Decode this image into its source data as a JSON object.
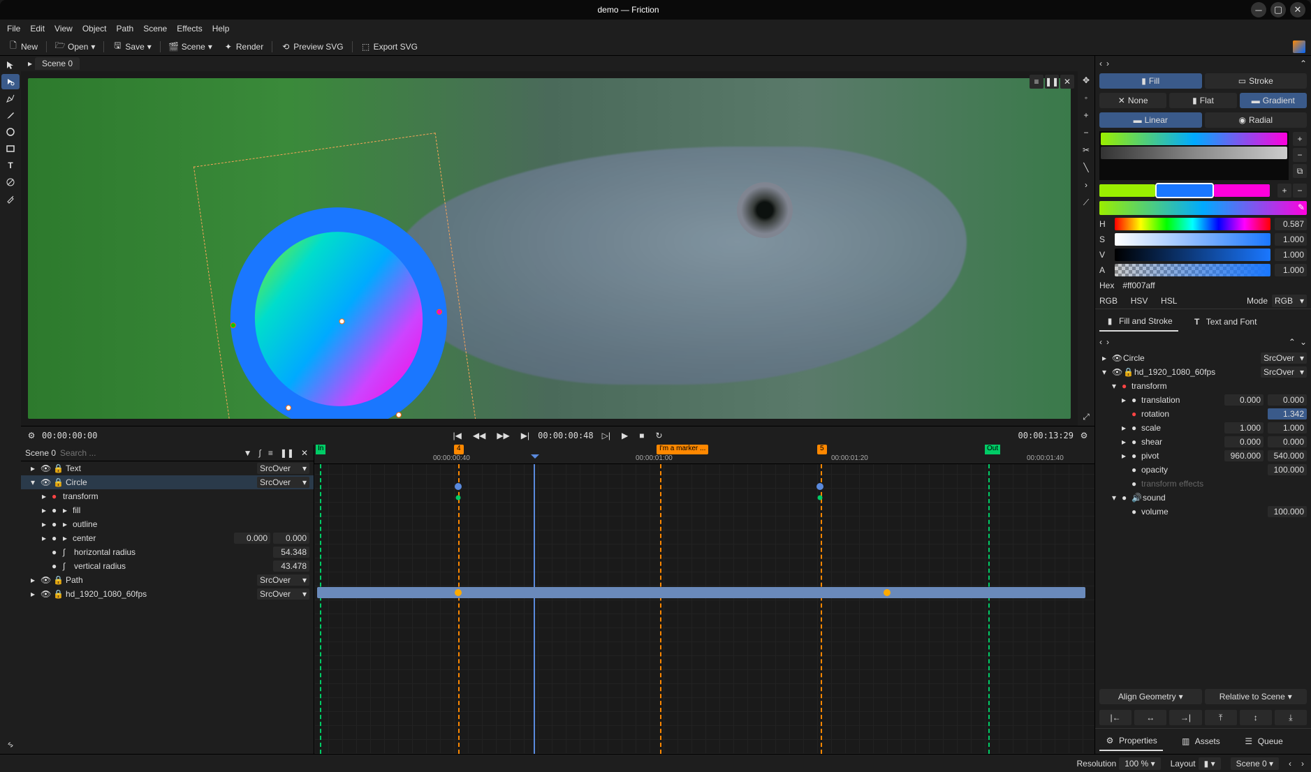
{
  "window": {
    "title": "demo — Friction"
  },
  "menus": [
    "File",
    "Edit",
    "View",
    "Object",
    "Path",
    "Scene",
    "Effects",
    "Help"
  ],
  "toolbar": {
    "new": "New",
    "open": "Open",
    "save": "Save",
    "scene": "Scene",
    "render": "Render",
    "preview_svg": "Preview SVG",
    "export_svg": "Export SVG"
  },
  "scene_tab": "Scene 0",
  "fillstroke": {
    "fill": "Fill",
    "stroke": "Stroke",
    "none": "None",
    "flat": "Flat",
    "gradient": "Gradient",
    "linear": "Linear",
    "radial": "Radial"
  },
  "color": {
    "h": {
      "label": "H",
      "val": "0.587"
    },
    "s": {
      "label": "S",
      "val": "1.000"
    },
    "v": {
      "label": "V",
      "val": "1.000"
    },
    "a": {
      "label": "A",
      "val": "1.000"
    },
    "hex_label": "Hex",
    "hex": "#ff007aff",
    "rgb": "RGB",
    "hsv": "HSV",
    "hsl": "HSL",
    "mode_label": "Mode",
    "mode": "RGB"
  },
  "panel_tabs": {
    "fillstroke": "Fill and Stroke",
    "text": "Text and Font"
  },
  "tree": [
    {
      "indent": 0,
      "exp": "▸",
      "name": "Circle",
      "blend": "SrcOver"
    },
    {
      "indent": 0,
      "exp": "▾",
      "name": "hd_1920_1080_60fps",
      "blend": "SrcOver",
      "lock": true
    },
    {
      "indent": 1,
      "exp": "▾",
      "name": "transform",
      "red": true
    },
    {
      "indent": 2,
      "exp": "▸",
      "name": "translation",
      "vals": [
        "0.000",
        "0.000"
      ]
    },
    {
      "indent": 2,
      "name": "rotation",
      "vals": [
        "1.342"
      ],
      "sel": true,
      "red": true
    },
    {
      "indent": 2,
      "exp": "▸",
      "name": "scale",
      "vals": [
        "1.000",
        "1.000"
      ]
    },
    {
      "indent": 2,
      "exp": "▸",
      "name": "shear",
      "vals": [
        "0.000",
        "0.000"
      ]
    },
    {
      "indent": 2,
      "exp": "▸",
      "name": "pivot",
      "vals": [
        "960.000",
        "540.000"
      ]
    },
    {
      "indent": 2,
      "name": "opacity",
      "vals": [
        "100.000"
      ]
    },
    {
      "indent": 2,
      "name": "transform effects",
      "dim": true
    },
    {
      "indent": 1,
      "exp": "▾",
      "name": "sound",
      "sound": true
    },
    {
      "indent": 2,
      "name": "volume",
      "vals": [
        "100.000"
      ]
    }
  ],
  "align": {
    "geom": "Align Geometry",
    "rel": "Relative to Scene"
  },
  "bottom_tabs": {
    "props": "Properties",
    "assets": "Assets",
    "queue": "Queue"
  },
  "timeline": {
    "start": "00:00:00:00",
    "current": "00:00:00:48",
    "end": "00:00:13:29",
    "scene": "Scene 0",
    "search_ph": "Search ...",
    "ticks": [
      "00:00:00:40",
      "00:00:01:00",
      "00:00:01:20",
      "00:00:01:40"
    ],
    "markers": {
      "in": "In",
      "out": "Out",
      "m4": "4",
      "m5": "5",
      "text": "I'm a marker ..."
    },
    "items": [
      {
        "indent": 0,
        "exp": "▸",
        "name": "Text",
        "blend": "SrcOver",
        "vis": true,
        "lock": true
      },
      {
        "indent": 0,
        "exp": "▾",
        "name": "Circle",
        "blend": "SrcOver",
        "vis": true,
        "lock": true,
        "sel": true
      },
      {
        "indent": 1,
        "exp": "▸",
        "name": "transform",
        "red": true
      },
      {
        "indent": 1,
        "exp": "▸",
        "name": "fill"
      },
      {
        "indent": 1,
        "exp": "▸",
        "name": "outline"
      },
      {
        "indent": 1,
        "exp": "▸",
        "name": "center",
        "vals": [
          "0.000",
          "0.000"
        ]
      },
      {
        "indent": 1,
        "name": "horizontal radius",
        "vals": [
          "54.348"
        ],
        "curve": true
      },
      {
        "indent": 1,
        "name": "vertical radius",
        "vals": [
          "43.478"
        ],
        "curve": true
      },
      {
        "indent": 0,
        "exp": "▸",
        "name": "Path",
        "blend": "SrcOver",
        "vis": true,
        "lock": true
      },
      {
        "indent": 0,
        "exp": "▸",
        "name": "hd_1920_1080_60fps",
        "blend": "SrcOver",
        "vis": true,
        "lock": true
      }
    ]
  },
  "statusbar": {
    "resolution_label": "Resolution",
    "resolution": "100 %",
    "layout_label": "Layout",
    "scene": "Scene 0"
  }
}
